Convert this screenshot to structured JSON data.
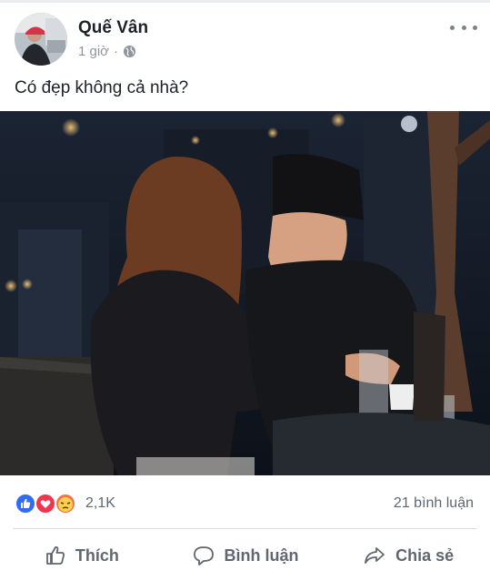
{
  "post": {
    "author": "Quế Vân",
    "time": "1 giờ",
    "separator": "·",
    "caption": "Có đẹp không cả nhà?"
  },
  "icons": {
    "more": "more-icon",
    "globe": "globe-icon",
    "like_reaction": "like-reaction-icon",
    "love_reaction": "love-reaction-icon",
    "angry_reaction": "angry-reaction-icon",
    "like_action": "thumbs-up-icon",
    "comment_action": "speech-bubble-icon",
    "share_action": "share-arrow-icon"
  },
  "stats": {
    "reactions": "2,1K",
    "comments": "21 bình luận"
  },
  "actions": {
    "like": "Thích",
    "comment": "Bình luận",
    "share": "Chia sẻ"
  },
  "colors": {
    "like_blue": "#2f6cf2",
    "love_red": "#f0364f",
    "angry_orange": "#f7714c",
    "text_gray": "#606770"
  }
}
